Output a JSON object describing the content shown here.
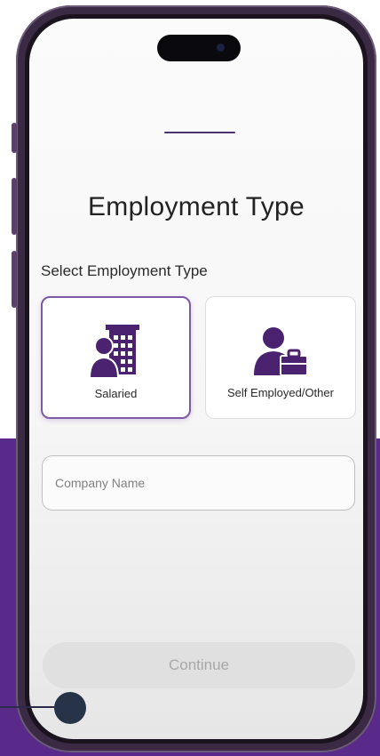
{
  "page": {
    "title": "Employment Type",
    "subtitle": "Select Employment Type"
  },
  "employment_options": [
    {
      "label": "Salaried",
      "icon": "office-worker-icon",
      "selected": true
    },
    {
      "label": "Self Employed/Other",
      "icon": "person-briefcase-icon",
      "selected": false
    }
  ],
  "company_field": {
    "placeholder": "Company Name",
    "value": ""
  },
  "actions": {
    "continue_label": "Continue"
  },
  "colors": {
    "accent": "#5a2a8a",
    "icon": "#4b2270",
    "selected_border": "#7d5aa6",
    "disabled_button": "#e0e0e0"
  }
}
